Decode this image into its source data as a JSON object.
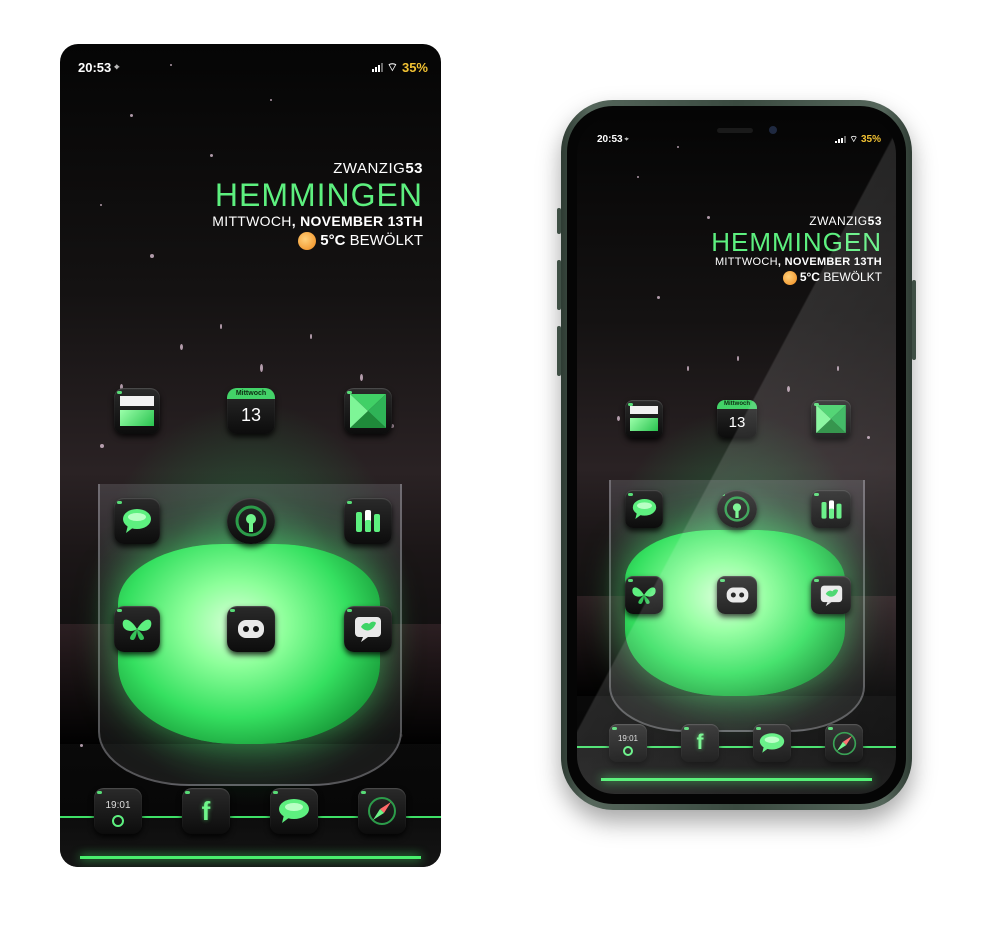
{
  "status_bar": {
    "time": "20:53",
    "battery": "35%"
  },
  "widget": {
    "word_prefix": "ZWANZIG",
    "word_number": "53",
    "city": "HEMMINGEN",
    "weekday": "MITTWOCH",
    "date_sep": ", ",
    "date": "NOVEMBER 13TH",
    "temperature": "5°C",
    "condition": "BEWÖLKT"
  },
  "icons": [
    {
      "id": "tile-app"
    },
    {
      "id": "calendar",
      "header": "Mittwoch",
      "day": "13"
    },
    {
      "id": "hourglass-app"
    },
    {
      "id": "messages-app"
    },
    {
      "id": "podcast-app"
    },
    {
      "id": "settings-sliders"
    },
    {
      "id": "butterfly-app"
    },
    {
      "id": "discord-app"
    },
    {
      "id": "twitter-app"
    }
  ],
  "dock": [
    {
      "id": "clock-app",
      "time": "19:01"
    },
    {
      "id": "facebook-app",
      "glyph": "f"
    },
    {
      "id": "chat-app"
    },
    {
      "id": "compass-app"
    }
  ],
  "colors": {
    "accent": "#5df07f",
    "battery": "#f2c233",
    "bezel": "#3a4a40"
  }
}
